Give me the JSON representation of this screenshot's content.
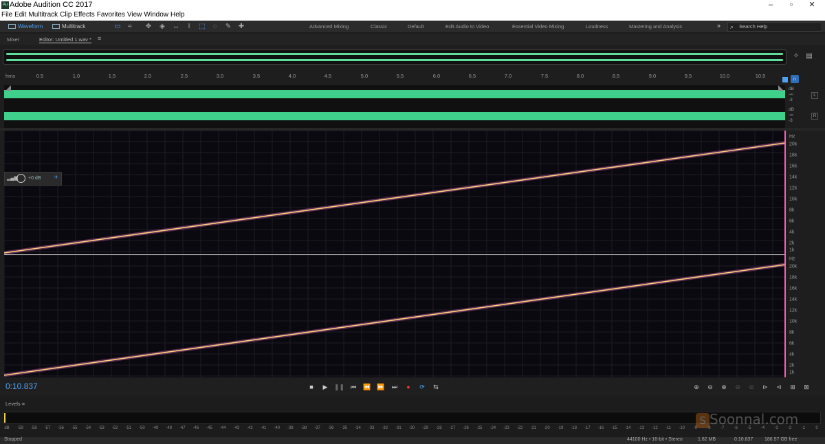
{
  "window": {
    "title": "Adobe Audition CC 2017",
    "app_icon": "Au"
  },
  "menubar": {
    "items": [
      "File",
      "Edit",
      "Multitrack",
      "Clip",
      "Effects",
      "Favorites",
      "View",
      "Window",
      "Help"
    ]
  },
  "toolbar": {
    "modes": [
      {
        "label": "Waveform",
        "active": true
      },
      {
        "label": "Multitrack",
        "active": false
      }
    ],
    "workspaces": [
      "Advanced Mixing",
      "Classic",
      "Default",
      "Edit Audio to Video",
      "Essential Video Mixing",
      "Loudness",
      "Mastering and Analysis"
    ],
    "more": "»",
    "search_placeholder": "Search Help"
  },
  "panels": {
    "mixer": "Mixer",
    "editor": "Editor: Untitled 1.wav *",
    "menu": "≡"
  },
  "ruler": {
    "unit": "hms",
    "ticks": [
      "0.5",
      "1.0",
      "1.5",
      "2.0",
      "2.5",
      "3.0",
      "3.5",
      "4.0",
      "4.5",
      "5.0",
      "5.5",
      "6.0",
      "6.5",
      "7.0",
      "7.5",
      "8.0",
      "8.5",
      "9.0",
      "9.5",
      "10.0",
      "10.5"
    ]
  },
  "waveform": {
    "left_scale": [
      "dB",
      "-∞",
      "-3"
    ],
    "right_scale": [
      "dB",
      "-∞",
      "-3"
    ],
    "left_badge": "L",
    "right_badge": "R",
    "wave_color": "#3fd18b"
  },
  "hud": {
    "value": "+0 dB"
  },
  "spectral": {
    "unit": "Hz",
    "freq_labels": [
      "20k",
      "18k",
      "16k",
      "14k",
      "12k",
      "10k",
      "8k",
      "6k",
      "4k",
      "2k",
      "1k"
    ],
    "sweep_color": "#ffd27a"
  },
  "transport": {
    "time": "0:10.837"
  },
  "levels": {
    "title": "Levels",
    "db_ticks": [
      "dB",
      "-59",
      "-58",
      "-57",
      "-56",
      "-55",
      "-54",
      "-53",
      "-52",
      "-51",
      "-50",
      "-49",
      "-48",
      "-47",
      "-46",
      "-45",
      "-44",
      "-43",
      "-42",
      "-41",
      "-40",
      "-39",
      "-38",
      "-37",
      "-36",
      "-35",
      "-34",
      "-33",
      "-32",
      "-31",
      "-30",
      "-29",
      "-28",
      "-27",
      "-26",
      "-25",
      "-24",
      "-23",
      "-22",
      "-21",
      "-20",
      "-19",
      "-18",
      "-17",
      "-16",
      "-15",
      "-14",
      "-13",
      "-12",
      "-11",
      "-10",
      "-9",
      "-8",
      "-7",
      "-6",
      "-5",
      "-4",
      "-3",
      "-2",
      "-1",
      "0"
    ]
  },
  "status": {
    "state": "Stopped",
    "format": "44100 Hz • 16-bit • Stereo",
    "size": "1.82 MB",
    "duration": "0:10.837",
    "free": "186.57 GB free"
  },
  "watermark": {
    "text": "Soonnal.com"
  }
}
